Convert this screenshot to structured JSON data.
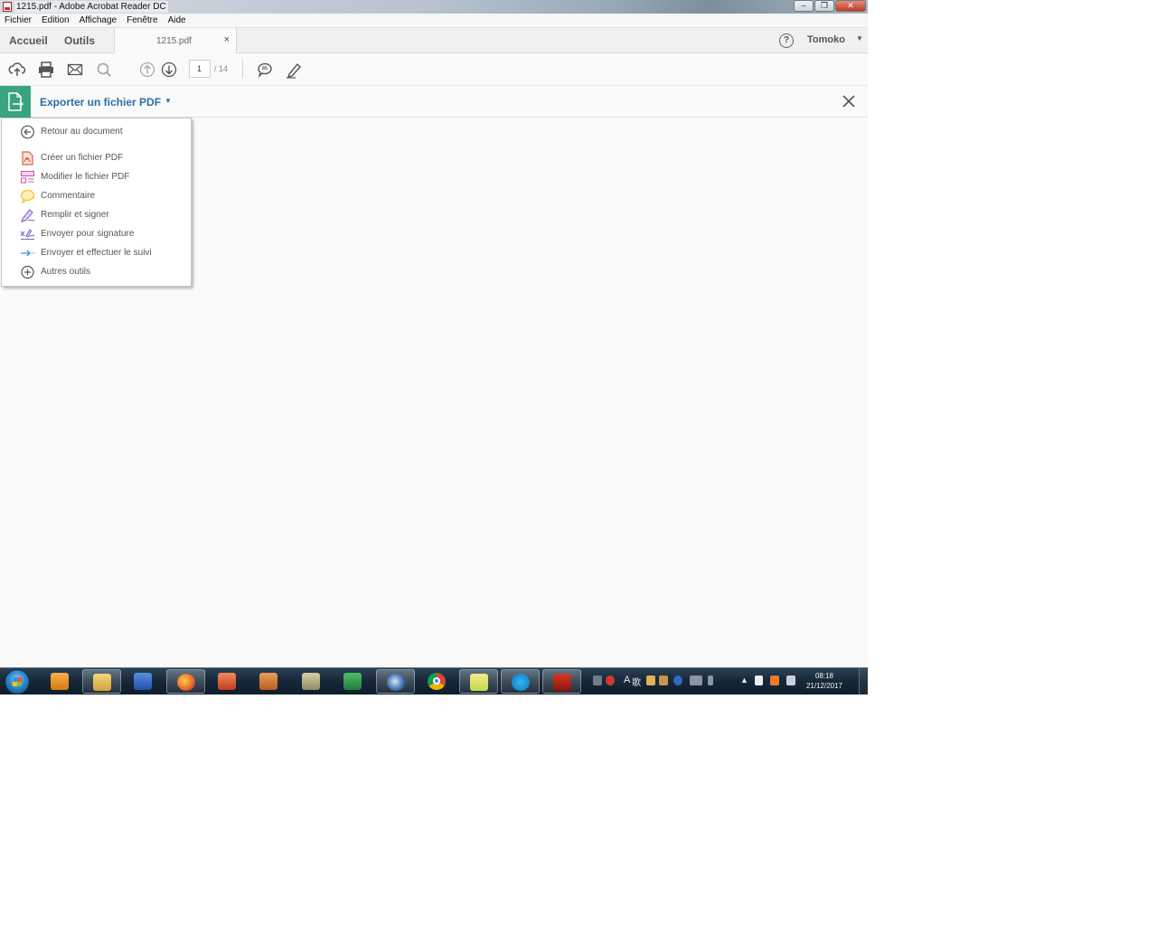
{
  "window": {
    "title": "1215.pdf - Adobe Acrobat Reader DC",
    "minimize": "–",
    "maximize": "❐",
    "close": "✕"
  },
  "menubar": [
    "Fichier",
    "Edition",
    "Affichage",
    "Fenêtre",
    "Aide"
  ],
  "tabs": {
    "home": "Accueil",
    "tools": "Outils",
    "document": "1215.pdf",
    "close_glyph": "×"
  },
  "user": {
    "name": "Tomoko"
  },
  "toolbar": {
    "page_current": "1",
    "page_total": "/ 14"
  },
  "tool_pane": {
    "title": "Exporter un fichier PDF"
  },
  "dropdown": {
    "items": [
      {
        "label": "Retour au document",
        "icon": "back-arrow-icon"
      },
      {
        "label": "Créer un fichier PDF",
        "icon": "create-pdf-icon"
      },
      {
        "label": "Modifier le fichier PDF",
        "icon": "edit-pdf-icon"
      },
      {
        "label": "Commentaire",
        "icon": "comment-icon"
      },
      {
        "label": "Remplir et signer",
        "icon": "fill-sign-icon"
      },
      {
        "label": "Envoyer pour signature",
        "icon": "send-signature-icon"
      },
      {
        "label": "Envoyer et effectuer le suivi",
        "icon": "send-track-icon"
      },
      {
        "label": "Autres outils",
        "icon": "more-tools-icon"
      }
    ]
  },
  "taskbar": {
    "tray_text_a": "A",
    "tray_text_b": "歌",
    "clock_time": "08:18",
    "clock_date": "21/12/2017"
  },
  "colors": {
    "accent_green": "#3aa37f",
    "link_blue": "#2d6ea3",
    "create_pdf": "#e0604a",
    "edit_pdf": "#d25aa9",
    "comment": "#f2c230",
    "fill_sign": "#8a68c9",
    "send_sign": "#7b5fc4",
    "send_track": "#3f8fd6"
  }
}
